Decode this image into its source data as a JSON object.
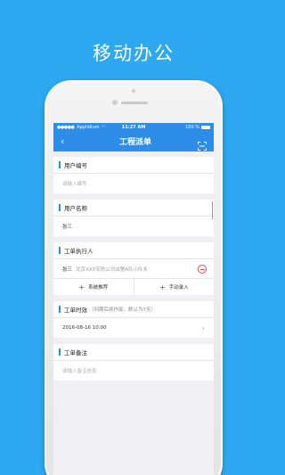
{
  "promo": {
    "headline": "移动办公"
  },
  "status_bar": {
    "carrier": "Applidium",
    "time": "11:27 AM",
    "battery": "100 %"
  },
  "nav": {
    "back_icon": "‹",
    "title": "工程派单",
    "scan_icon": "scan-icon"
  },
  "sections": {
    "user_number": {
      "title": "用户编号",
      "placeholder": "请输入编号"
    },
    "user_name": {
      "title": "用户名称",
      "value": "张三"
    },
    "executor": {
      "title": "工单执行人",
      "name": "张三",
      "detail": "北京XXX安防公司出警A队小队长",
      "actions": [
        {
          "icon": "+",
          "label": "系统推荐"
        },
        {
          "icon": "+",
          "label": "手动录入"
        }
      ]
    },
    "timeliness": {
      "title": "工单时效",
      "hint": "（到期后将作废，默认为7天）",
      "value": "2016-08-16 10:00"
    },
    "remark": {
      "title": "工单备注",
      "placeholder": "请输入备注信息"
    }
  },
  "colors": {
    "background": "#2ea8f0",
    "nav": "#2e8de8",
    "danger": "#e94b4b"
  }
}
